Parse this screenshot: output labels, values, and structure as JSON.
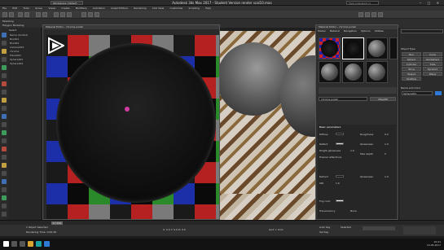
{
  "titlebar": {
    "workspace": "Workspace: Default",
    "title": "Autodesk 3ds Max 2017 - Student Version   render scal10.max",
    "search_placeholder": "Type a keyword or phrase"
  },
  "menus": [
    "File",
    "Edit",
    "Tools",
    "Group",
    "Views",
    "Create",
    "Modifiers",
    "Animation",
    "Graph Editors",
    "Rendering",
    "Civil View",
    "Customize",
    "Scripting",
    "Help"
  ],
  "ribbon": {
    "tab1": "Modeling",
    "tab2": "Polygon Modeling"
  },
  "scene": {
    "header": "Select",
    "items": [
      "Name (Sorted)",
      "Box001",
      "Box002",
      "Camera001",
      "chrome",
      "Plane001",
      "Sphere001",
      "Sphere002"
    ]
  },
  "material_view": {
    "caption": "Material Editor - chrome polish"
  },
  "sme": {
    "caption": "Material Editor - chrome polish",
    "menus": [
      "Modes",
      "Material",
      "Navigation",
      "Options",
      "Utilities"
    ],
    "material_name": "chrome polish",
    "section": "Basic parameters",
    "params": [
      {
        "label": "Diffuse",
        "value": ""
      },
      {
        "label": "Roughness",
        "value": "0.0"
      },
      {
        "label": "Reflect",
        "value": ""
      },
      {
        "label": "Glossiness",
        "value": "1.0"
      },
      {
        "label": "Hilight glossiness",
        "value": "1.0"
      },
      {
        "label": "Fresnel reflections",
        "value": ""
      },
      {
        "label": "Max depth",
        "value": "5"
      },
      {
        "label": "Refract",
        "value": ""
      },
      {
        "label": "Glossiness",
        "value": "1.0"
      },
      {
        "label": "IOR",
        "value": "1.6"
      },
      {
        "label": "Fog color",
        "value": ""
      },
      {
        "label": "Translucency",
        "value": "None"
      }
    ]
  },
  "cmdpanel": {
    "header": "Object Type",
    "buttons": [
      "Box",
      "Cone",
      "Sphere",
      "GeoSphere",
      "Cylinder",
      "Tube",
      "Torus",
      "Pyramid",
      "Teapot",
      "Plane",
      "TextPlus"
    ],
    "name_header": "Name and Color",
    "name_value": "Sphere001"
  },
  "timeline": {
    "frame": "0 / 100"
  },
  "status": {
    "line1": "1 Object Selected",
    "line2": "Rendering Time: 0:00:46",
    "coords": "X: 0.0   Y: 0.0   Z: 0.0",
    "grid": "Grid = 10.0",
    "autokey": "Auto Key",
    "selected": "Selected",
    "setkey": "Set Key"
  },
  "taskbar": {
    "time": "10:21",
    "date": "15.05.2017"
  },
  "colors": {
    "accent": "#2e7ad6",
    "cursor": "#d03ca0"
  },
  "icons": [
    "windows-start-icon",
    "search-icon",
    "task-view-icon",
    "folder-icon",
    "3dsmax-icon",
    "browser-icon"
  ]
}
